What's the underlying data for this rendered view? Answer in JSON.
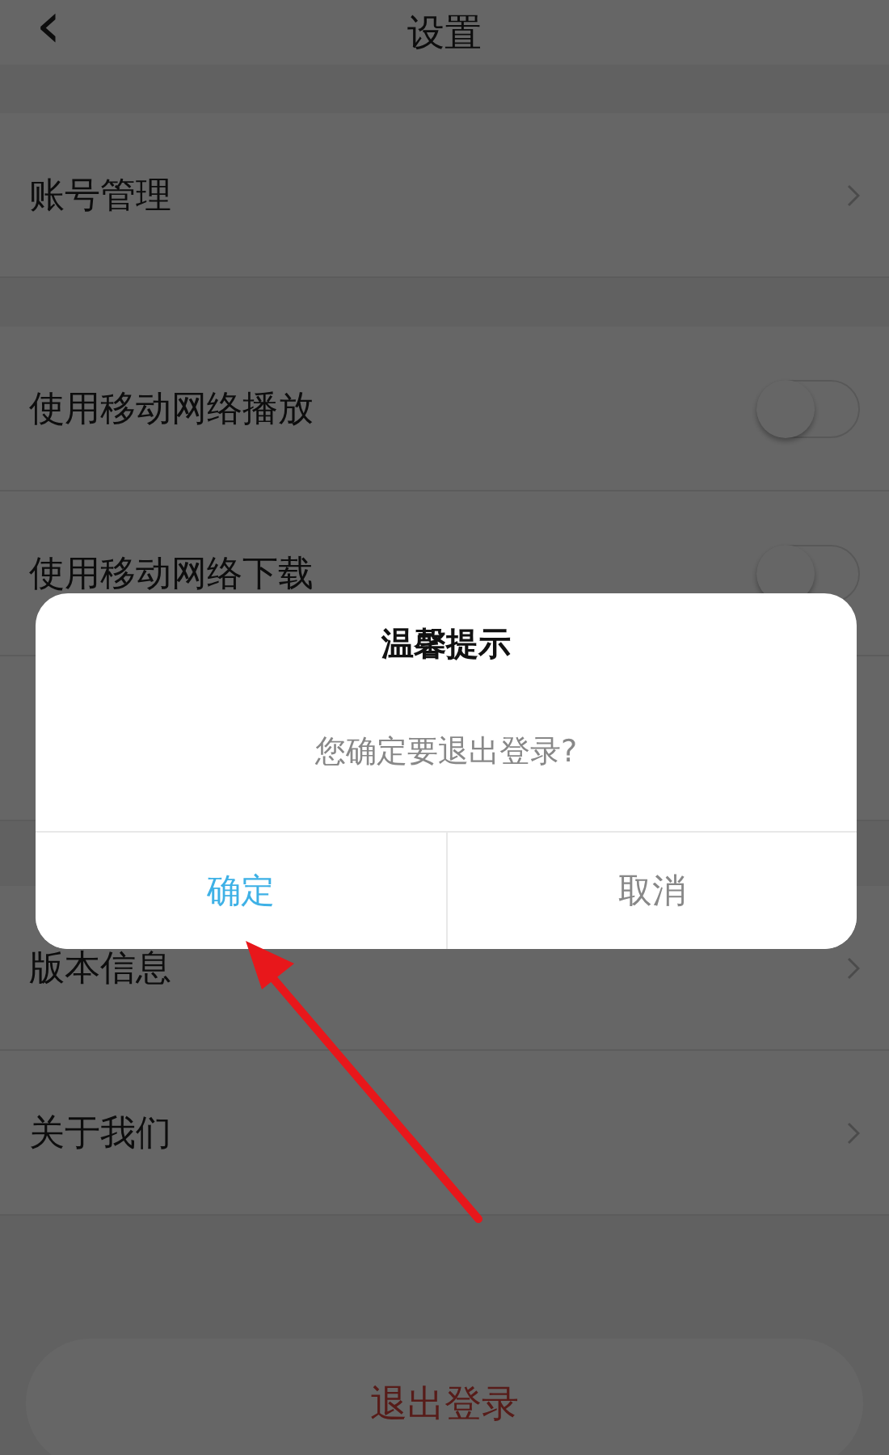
{
  "header": {
    "back": "‹",
    "title": "设置"
  },
  "groups": [
    {
      "items": [
        {
          "kind": "link",
          "label": "账号管理"
        }
      ]
    },
    {
      "items": [
        {
          "kind": "toggle",
          "label": "使用移动网络播放",
          "on": false
        },
        {
          "kind": "toggle",
          "label": "使用移动网络下载",
          "on": false
        },
        {
          "kind": "hidden"
        }
      ]
    },
    {
      "items": [
        {
          "kind": "link",
          "label": "版本信息"
        },
        {
          "kind": "link",
          "label": "关于我们"
        }
      ]
    }
  ],
  "logout_button": "退出登录",
  "dialog": {
    "title": "温馨提示",
    "message": "您确定要退出登录?",
    "buttons": [
      {
        "label": "确定",
        "kind": "primary"
      },
      {
        "label": "取消",
        "kind": "secondary"
      }
    ]
  }
}
